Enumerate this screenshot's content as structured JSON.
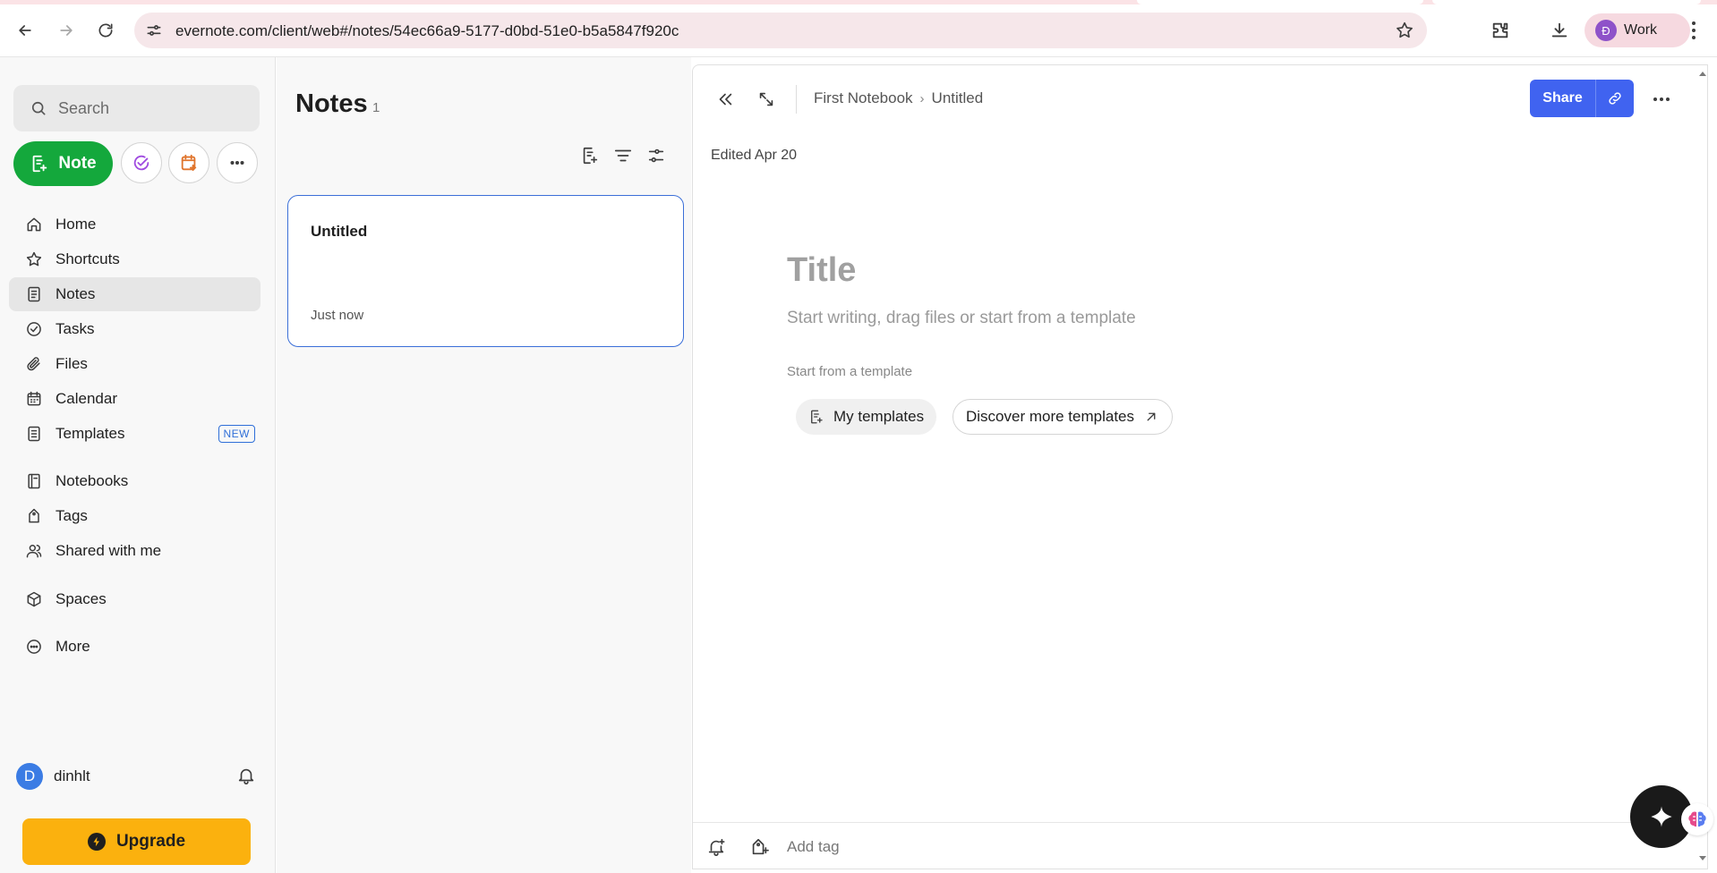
{
  "browser": {
    "url": "evernote.com/client/web#/notes/54ec66a9-5177-d0bd-51e0-b5a5847f920c",
    "profile_initial": "Đ",
    "profile_label": "Work"
  },
  "sidebar": {
    "search_placeholder": "Search",
    "note_button": "Note",
    "items": [
      {
        "label": "Home",
        "icon": "home-icon"
      },
      {
        "label": "Shortcuts",
        "icon": "star-icon"
      },
      {
        "label": "Notes",
        "icon": "notes-icon",
        "active": true
      },
      {
        "label": "Tasks",
        "icon": "tasks-icon"
      },
      {
        "label": "Files",
        "icon": "paperclip-icon"
      },
      {
        "label": "Calendar",
        "icon": "calendar-icon"
      },
      {
        "label": "Templates",
        "icon": "templates-icon",
        "badge": "NEW"
      },
      {
        "label": "Notebooks",
        "icon": "notebook-icon"
      },
      {
        "label": "Tags",
        "icon": "tag-icon"
      },
      {
        "label": "Shared with me",
        "icon": "users-icon"
      },
      {
        "label": "Spaces",
        "icon": "cube-icon"
      },
      {
        "label": "More",
        "icon": "more-circle-icon"
      }
    ],
    "user": {
      "initial": "D",
      "name": "dinhlt"
    },
    "upgrade_label": "Upgrade"
  },
  "notes_list": {
    "title": "Notes",
    "count": "1",
    "notes": [
      {
        "title": "Untitled",
        "date": "Just now"
      }
    ]
  },
  "editor": {
    "breadcrumb": {
      "notebook": "First Notebook",
      "note": "Untitled"
    },
    "share_label": "Share",
    "edited": "Edited Apr 20",
    "title_placeholder": "Title",
    "body_placeholder": "Start writing, drag files or start from a template",
    "template_label": "Start from a template",
    "my_templates": "My templates",
    "discover_templates": "Discover more templates",
    "add_tag_placeholder": "Add tag"
  },
  "colors": {
    "note_button": "#14a83c",
    "share_button": "#4063f0",
    "upgrade_button": "#fbb10e",
    "selected_card_border": "#3b6fd8"
  }
}
